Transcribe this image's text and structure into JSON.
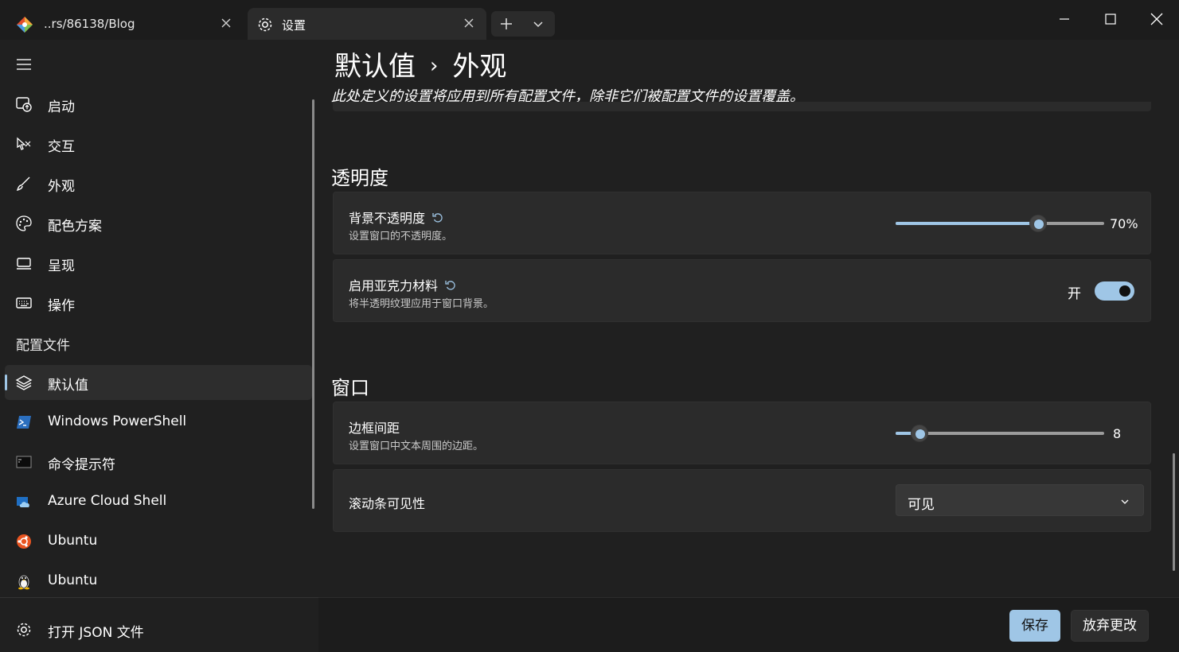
{
  "tabs": [
    {
      "label": "..rs/86138/Blog",
      "icon": "git-diamond-icon",
      "active": false
    },
    {
      "label": "设置",
      "icon": "gear-icon",
      "active": true
    }
  ],
  "sidebar": {
    "items": [
      {
        "label": "启动",
        "icon": "startup-icon"
      },
      {
        "label": "交互",
        "icon": "interaction-icon"
      },
      {
        "label": "外观",
        "icon": "brush-icon"
      },
      {
        "label": "配色方案",
        "icon": "palette-icon"
      },
      {
        "label": "呈现",
        "icon": "monitor-icon"
      },
      {
        "label": "操作",
        "icon": "keyboard-icon"
      }
    ],
    "profiles_header": "配置文件",
    "profiles": [
      {
        "label": "默认值",
        "icon": "layers-icon",
        "selected": true
      },
      {
        "label": "Windows PowerShell",
        "icon": "powershell-icon"
      },
      {
        "label": "命令提示符",
        "icon": "cmd-icon"
      },
      {
        "label": "Azure Cloud Shell",
        "icon": "azure-cloud-icon"
      },
      {
        "label": "Ubuntu",
        "icon": "ubuntu-icon"
      },
      {
        "label": "Ubuntu",
        "icon": "linux-penguin-icon"
      }
    ],
    "open_json": "打开 JSON 文件"
  },
  "main": {
    "breadcrumb": {
      "parent": "默认值",
      "separator": "›",
      "current": "外观"
    },
    "subtitle": "此处定义的设置将应用到所有配置文件，除非它们被配置文件的设置覆盖。",
    "transparency": {
      "title": "透明度",
      "opacity": {
        "title": "背景不透明度",
        "desc": "设置窗口的不透明度。",
        "value_pct": 70,
        "value_label": "70%"
      },
      "acrylic": {
        "title": "启用亚克力材料",
        "desc": "将半透明纹理应用于窗口背景。",
        "state_label": "开",
        "on": true
      }
    },
    "window": {
      "title": "窗口",
      "padding": {
        "title": "边框间距",
        "desc": "设置窗口中文本周围的边距。",
        "value": 8,
        "max": 100,
        "value_label": "8"
      },
      "scrollbar": {
        "title": "滚动条可见性",
        "selected": "可见"
      }
    }
  },
  "footer": {
    "save": "保存",
    "discard": "放弃更改"
  },
  "colors": {
    "accent": "#9fc6e6",
    "background": "#202020",
    "card": "#2b2b2b"
  }
}
